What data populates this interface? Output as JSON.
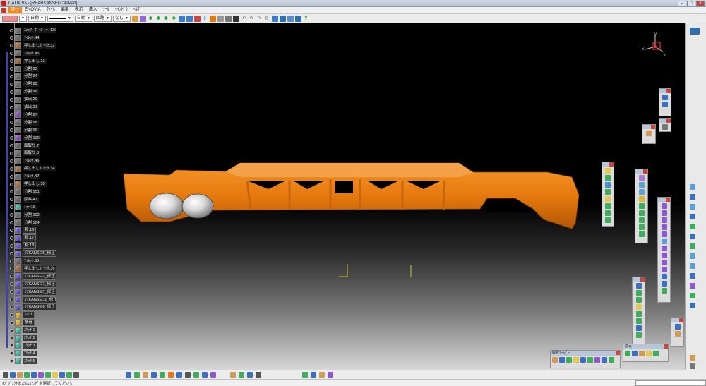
{
  "window": {
    "title": "CATIA V5 - [REARKANSEI.CATPart]",
    "minimize_label": "–",
    "maximize_label": "□",
    "close_label": "×"
  },
  "menu": {
    "items": [
      "ｽﾀｰﾄ",
      "ENOVIA",
      "ﾌｧｲﾙ",
      "編集",
      "表示",
      "挿入",
      "ﾂｰﾙ",
      "ｳｨﾝﾄﾞｳ",
      "ﾍﾙﾌﾟ"
    ]
  },
  "toolbar": {
    "line_weight": "自動",
    "line_type": "自動",
    "layer": "回路",
    "render_style": "なし"
  },
  "tree": {
    "items": [
      {
        "label": "ｽﾃｯﾌﾟ ｹﾞｰｼﾞ = -130mm",
        "icon": "feat"
      },
      {
        "label": "ﾌｨﾚｯﾄ.44",
        "icon": "feat"
      },
      {
        "label": "押し出しﾎﾟｹｯﾄ.32",
        "icon": "pocket"
      },
      {
        "label": "ﾌｨﾚｯﾄ.45",
        "icon": "feat"
      },
      {
        "label": "押し出し.33",
        "icon": "pocket"
      },
      {
        "label": "分割.93",
        "icon": "feat"
      },
      {
        "label": "分割.94",
        "icon": "feat"
      },
      {
        "label": "分割.95",
        "icon": "feat"
      },
      {
        "label": "分割.96",
        "icon": "feat"
      },
      {
        "label": "抽出.20",
        "icon": "feat"
      },
      {
        "label": "抽出.21",
        "icon": "feat"
      },
      {
        "label": "分割.97",
        "icon": "pad"
      },
      {
        "label": "分割.98",
        "icon": "feat"
      },
      {
        "label": "分割.99",
        "icon": "feat"
      },
      {
        "label": "分割.100",
        "icon": "pad"
      },
      {
        "label": "面取り.7",
        "icon": "feat"
      },
      {
        "label": "面取り.8",
        "icon": "feat"
      },
      {
        "label": "ﾌｨﾚｯﾄ.46",
        "icon": "feat"
      },
      {
        "label": "押し出しﾎﾟｹｯﾄ.34",
        "icon": "pocket"
      },
      {
        "label": "ﾌｨﾚｯﾄ.47",
        "icon": "feat"
      },
      {
        "label": "押し出し.35",
        "icon": "pocket"
      },
      {
        "label": "分割.101",
        "icon": "feat"
      },
      {
        "label": "厚み.47",
        "icon": "feat"
      },
      {
        "label": "ﾐﾗｰ.18",
        "icon": "sketch"
      },
      {
        "label": "分割.102",
        "icon": "feat"
      },
      {
        "label": "分割.104",
        "icon": "feat"
      },
      {
        "label": "和.16",
        "icon": "surf"
      },
      {
        "label": "和.17",
        "icon": "surf"
      },
      {
        "label": "和.18",
        "icon": "surf"
      },
      {
        "label": "ﾘｱKANSEI6_修正",
        "icon": "surf"
      },
      {
        "label": "ﾌｨﾚｯﾄ.65",
        "icon": "feat"
      },
      {
        "label": "押し出しﾎﾟｹｯﾄ.36",
        "icon": "pocket"
      },
      {
        "label": "ﾘｱKANSEI2_修正",
        "icon": "surf"
      },
      {
        "label": "ﾘｱKANSEI1_修正",
        "icon": "surf"
      },
      {
        "label": "ﾘｱKANSEI7_修正",
        "icon": "surf"
      },
      {
        "label": "ﾘｱKANSEI10_修正",
        "icon": "surf"
      },
      {
        "label": "ﾘｱKANSEI9_修正",
        "icon": "surf"
      },
      {
        "label": "ﾌﾛﾝﾄ",
        "icon": "set"
      },
      {
        "label": "構造",
        "icon": "set"
      },
      {
        "label": "ｽｹｯﾁ.1",
        "icon": "sketch"
      },
      {
        "label": "ｽｹｯﾁ.2",
        "icon": "sketch"
      },
      {
        "label": "ｽｹｯﾁ.3",
        "icon": "sketch"
      },
      {
        "label": "ｽｹｯﾁ.4",
        "icon": "sketch"
      },
      {
        "label": "ｽｹｯﾁ.5",
        "icon": "sketch"
      }
    ]
  },
  "viewport": {
    "model_color": "#e6790e",
    "background_top": "#000000",
    "background_bottom": "#d7d7d7"
  },
  "compass": {
    "axis_x": "x",
    "axis_y": "y",
    "axis_z": "z"
  },
  "floating_toolbars": {
    "analysis_title": "解析ﾂｰﾙﾊﾞｰ",
    "trace_title": "拡大"
  },
  "status": {
    "prompt": "ｵﾌﾞｼﾞｪｸﾄまたはｺﾏﾝﾄﾞを選択してください"
  },
  "colors": {
    "accent": "#ee8a21",
    "tree_line": "#3d3dd8"
  }
}
